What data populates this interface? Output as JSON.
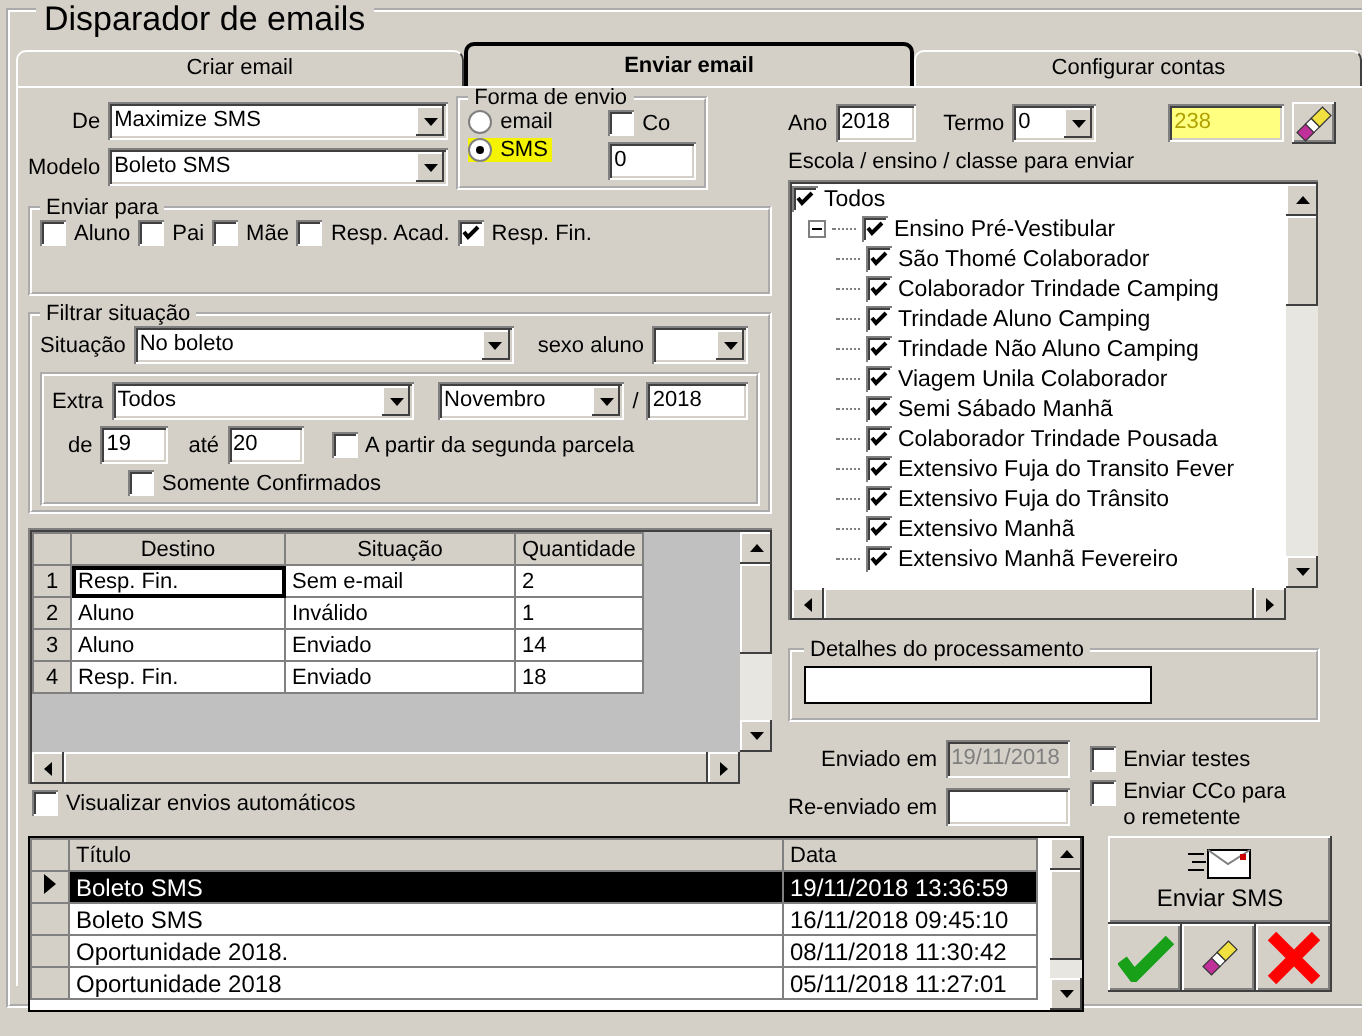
{
  "window": {
    "title": "Disparador de emails"
  },
  "tabs": [
    {
      "label": "Criar email",
      "selected": false
    },
    {
      "label": "Enviar email",
      "selected": true
    },
    {
      "label": "Configurar contas",
      "selected": false
    }
  ],
  "de": {
    "label": "De",
    "value": "Maximize SMS"
  },
  "modelo": {
    "label": "Modelo",
    "value": "Boleto SMS"
  },
  "forma_envio": {
    "title": "Forma de envio",
    "options": [
      {
        "label": "email",
        "selected": false,
        "highlighted": false
      },
      {
        "label": "SMS",
        "selected": true,
        "highlighted": true
      }
    ],
    "co": {
      "label": "Co",
      "checked": false
    },
    "count": "0"
  },
  "enviar_para": {
    "title": "Enviar para",
    "options": [
      {
        "label": "Aluno",
        "checked": false
      },
      {
        "label": "Pai",
        "checked": false
      },
      {
        "label": "Mãe",
        "checked": false
      },
      {
        "label": "Resp. Acad.",
        "checked": false
      },
      {
        "label": "Resp. Fin.",
        "checked": true
      }
    ]
  },
  "filtrar": {
    "title": "Filtrar situação",
    "situacao": {
      "label": "Situação",
      "value": "No boleto"
    },
    "sexo": {
      "label": "sexo aluno"
    },
    "extra": {
      "label": "Extra",
      "value": "Todos"
    },
    "mes": "Novembro",
    "separator": "/",
    "ano": "2018",
    "de": {
      "label": "de",
      "value": "19"
    },
    "ate": {
      "label": "até",
      "value": "20"
    },
    "segunda_parcela": {
      "label": "A partir da segunda parcela",
      "checked": false
    },
    "somente_confirmados": {
      "label": "Somente Confirmados",
      "checked": false
    }
  },
  "destinos": {
    "columns": [
      "Destino",
      "Situação",
      "Quantidade"
    ],
    "rows": [
      {
        "number": "1",
        "cells": [
          "Resp. Fin.",
          "Sem e-mail",
          "2"
        ]
      },
      {
        "number": "2",
        "cells": [
          "Aluno",
          "Inválido",
          "1"
        ]
      },
      {
        "number": "3",
        "cells": [
          "Aluno",
          "Enviado",
          "14"
        ]
      },
      {
        "number": "4",
        "cells": [
          "Resp. Fin.",
          "Enviado",
          "18"
        ]
      }
    ]
  },
  "visualizar": {
    "label": "Visualizar envios automáticos",
    "checked": false
  },
  "envios": {
    "columns": [
      "Título",
      "Data"
    ],
    "rows": [
      {
        "titulo": "Boleto SMS",
        "data": "19/11/2018 13:36:59",
        "selected": true
      },
      {
        "titulo": "Boleto SMS",
        "data": "16/11/2018 09:45:10",
        "selected": false
      },
      {
        "titulo": "Oportunidade 2018.",
        "data": "08/11/2018 11:30:42",
        "selected": false
      },
      {
        "titulo": "Oportunidade 2018",
        "data": "05/11/2018 11:27:01",
        "selected": false
      }
    ]
  },
  "ano": {
    "label": "Ano",
    "value": "2018"
  },
  "termo": {
    "label": "Termo",
    "value": "0"
  },
  "contador": "238",
  "escolas": {
    "label": "Escola / ensino / classe para enviar",
    "tree": [
      {
        "label": "Todos",
        "checked": true,
        "children": [
          {
            "label": "Ensino Pré-Vestibular",
            "checked": true,
            "expanded": true,
            "children": [
              {
                "label": "São Thomé Colaborador",
                "checked": true
              },
              {
                "label": "Colaborador Trindade Camping",
                "checked": true
              },
              {
                "label": "Trindade Aluno Camping",
                "checked": true
              },
              {
                "label": "Trindade Não Aluno Camping",
                "checked": true
              },
              {
                "label": "Viagem Unila Colaborador",
                "checked": true
              },
              {
                "label": "Semi Sábado Manhã",
                "checked": true
              },
              {
                "label": "Colaborador Trindade Pousada",
                "checked": true
              },
              {
                "label": "Extensivo Fuja do Transito Fever",
                "checked": true
              },
              {
                "label": "Extensivo Fuja do Trânsito",
                "checked": true
              },
              {
                "label": "Extensivo Manhã",
                "checked": true
              },
              {
                "label": "Extensivo Manhã Fevereiro",
                "checked": true
              }
            ]
          }
        ]
      }
    ]
  },
  "detalhes": {
    "title": "Detalhes do processamento"
  },
  "enviado_em": {
    "label": "Enviado em",
    "value": "19/11/2018",
    "disabled": true
  },
  "reenviado_em": {
    "label": "Re-enviado em"
  },
  "enviar_testes": {
    "label": "Enviar testes",
    "checked": false
  },
  "enviar_cco": {
    "label": "Enviar CCo para o remetente",
    "checked": false
  },
  "send_button": {
    "label": "Enviar SMS"
  }
}
